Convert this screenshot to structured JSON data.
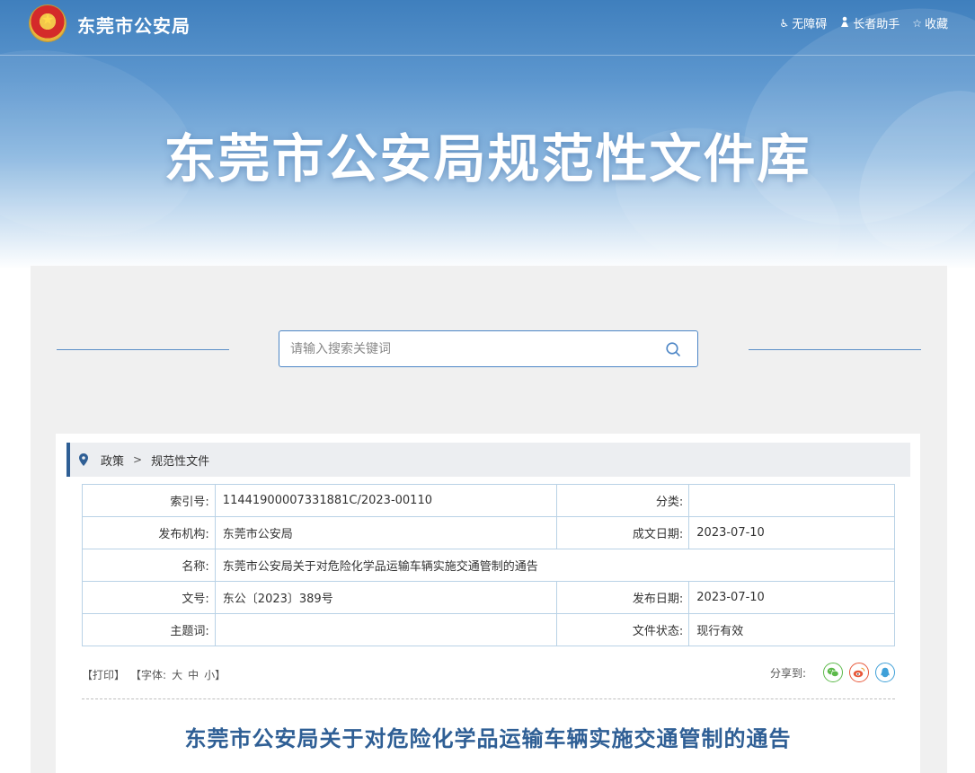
{
  "header": {
    "site_name": "东莞市公安局",
    "tools": {
      "accessibility": "无障碍",
      "elder_assist": "长者助手",
      "favorite": "收藏"
    },
    "banner_title": "东莞市公安局规范性文件库"
  },
  "search": {
    "placeholder": "请输入搜索关键词"
  },
  "breadcrumb": {
    "items": [
      "政策",
      "规范性文件"
    ]
  },
  "metadata": {
    "index_label": "索引号:",
    "index_value": "11441900007331881C/2023-00110",
    "category_label": "分类:",
    "category_value": "",
    "issuer_label": "发布机构:",
    "issuer_value": "东莞市公安局",
    "created_label": "成文日期:",
    "created_value": "2023-07-10",
    "name_label": "名称:",
    "name_value": "东莞市公安局关于对危险化学品运输车辆实施交通管制的通告",
    "doc_no_label": "文号:",
    "doc_no_value": "东公〔2023〕389号",
    "publish_label": "发布日期:",
    "publish_value": "2023-07-10",
    "subject_label": "主题词:",
    "subject_value": "",
    "status_label": "文件状态:",
    "status_value": "现行有效"
  },
  "doc_tools": {
    "print": "【打印】",
    "font_label": "【字体:",
    "font_large": "大",
    "font_medium": "中",
    "font_small": "小",
    "font_close": "】",
    "share_label": "分享到:"
  },
  "document": {
    "title": "东莞市公安局关于对危险化学品运输车辆实施交通管制的通告"
  },
  "colors": {
    "accent": "#2f5f95",
    "search_border": "#4d86c6",
    "table_border": "#b9d2e6",
    "wechat": "#5cb94a",
    "weibo": "#e8583a",
    "qq": "#3fa0d8"
  }
}
